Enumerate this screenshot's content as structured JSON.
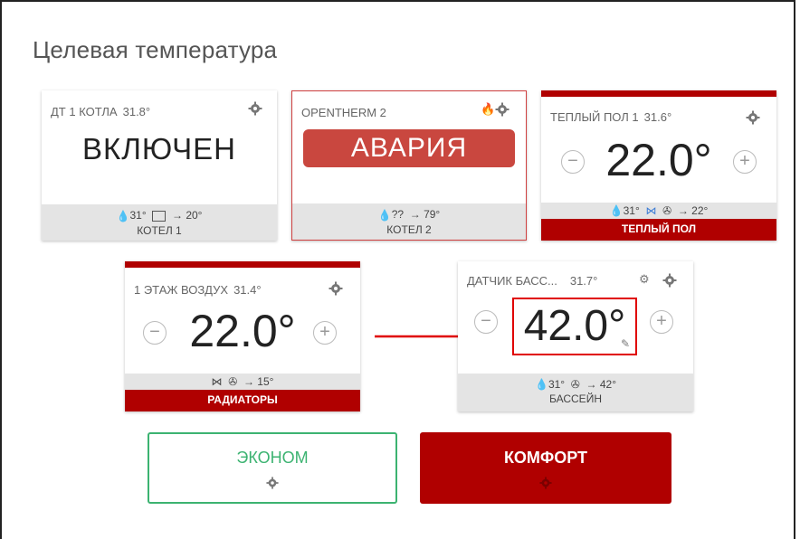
{
  "page": {
    "title": "Целевая температура"
  },
  "cards": {
    "kotel1": {
      "sensor": "ДТ 1 КОТЛА",
      "sensor_temp": "31.8°",
      "state": "ВКЛЮЧЕН",
      "stat_in": "31°",
      "stat_out": "→ 20°",
      "name": "КОТЕЛ 1"
    },
    "kotel2": {
      "sensor": "OPENTHERM 2",
      "state": "АВАРИЯ",
      "stat_in": "??",
      "stat_out": "→ 79°",
      "name": "КОТЕЛ 2",
      "alarm_color": "#c9473f"
    },
    "floor": {
      "sensor": "ТЕПЛЫЙ ПОЛ 1",
      "sensor_temp": "31.6°",
      "target": "22.0°",
      "stat_in": "31°",
      "stat_out": "→ 22°",
      "name": "ТЕПЛЫЙ ПОЛ"
    },
    "air": {
      "sensor": "1 ЭТАЖ ВОЗДУХ",
      "sensor_temp": "31.4°",
      "target": "22.0°",
      "stat_out": "→ 15°",
      "name": "РАДИАТОРЫ"
    },
    "pool": {
      "sensor": "ДАТЧИК БАСС...",
      "sensor_temp": "31.7°",
      "target": "42.0°",
      "stat_in": "31°",
      "stat_out": "→ 42°",
      "name": "БАССЕЙН"
    }
  },
  "modes": {
    "econom": {
      "label": "ЭКОНОМ",
      "color": "#3cb371"
    },
    "comfort": {
      "label": "КОМФОРТ",
      "color": "#b00000"
    }
  },
  "colors": {
    "accent_red": "#b00000",
    "highlight": "#e00000"
  },
  "icons": [
    "gear-icon",
    "flame-icon",
    "drop-icon",
    "pump-icon",
    "valve-icon",
    "fan-icon",
    "pencil-icon",
    "minus-icon",
    "plus-icon",
    "arrow-icon"
  ]
}
